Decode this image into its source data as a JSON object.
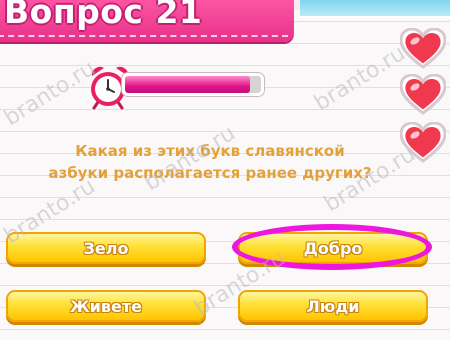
{
  "header": {
    "title": "Вопрос 21"
  },
  "timer": {
    "remaining_fraction": 0.92
  },
  "lives": {
    "count": 3,
    "icon": "heart-icon",
    "color": "#f0384f"
  },
  "question": {
    "line1": "Какая из этих букв славянской",
    "line2": "азбуки располагается ранее других?"
  },
  "answers": [
    {
      "label": "Зело",
      "highlighted": false
    },
    {
      "label": "Добро",
      "highlighted": true
    },
    {
      "label": "Живете",
      "highlighted": false
    },
    {
      "label": "Люди",
      "highlighted": false
    }
  ],
  "watermark": {
    "text": "branto.ru"
  },
  "colors": {
    "banner": "#e8318a",
    "answer_button": "#ffd21f",
    "question_text": "#e3a13a",
    "highlight": "#ee18dd"
  }
}
